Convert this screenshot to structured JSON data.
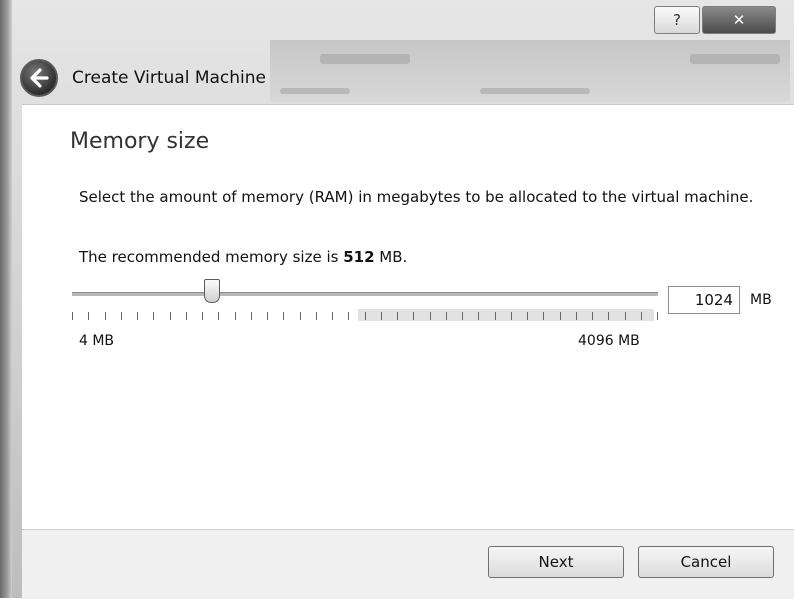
{
  "window": {
    "title": "Create Virtual Machine",
    "help_button": "?",
    "close_button": "✕"
  },
  "page": {
    "title": "Memory size",
    "description": "Select the amount of memory (RAM) in megabytes to be allocated to the virtual machine.",
    "recommended_prefix": "The recommended memory size is ",
    "recommended_value": "512",
    "recommended_suffix": " MB."
  },
  "memory": {
    "value": "1024",
    "unit": "MB",
    "min_label": "4 MB",
    "max_label": "4096 MB",
    "slider_min": 4,
    "slider_max": 4096,
    "slider_value": 1024
  },
  "buttons": {
    "next": "Next",
    "cancel": "Cancel"
  }
}
